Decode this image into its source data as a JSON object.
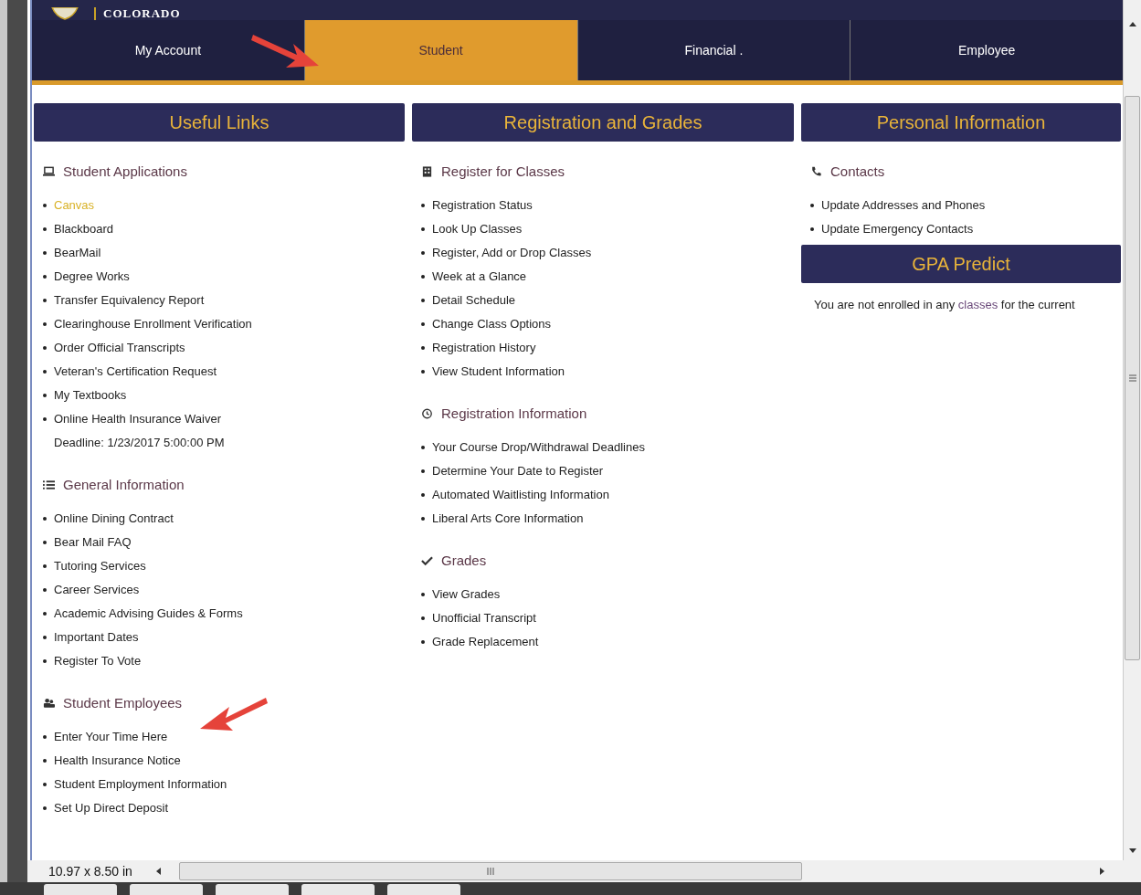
{
  "banner": {
    "title": "COLORADO"
  },
  "tabs": [
    {
      "label": "My Account",
      "selected": false
    },
    {
      "label": "Student",
      "selected": true
    },
    {
      "label": "Financial .",
      "selected": false
    },
    {
      "label": "Employee",
      "selected": false
    }
  ],
  "columns": [
    {
      "title": "Useful Links",
      "sections": [
        {
          "heading": "Student Applications",
          "kind": "laptop",
          "items": [
            {
              "label": "Canvas",
              "highlighted": true
            },
            {
              "label": "Blackboard",
              "highlighted": false
            },
            {
              "label": "BearMail",
              "highlighted": false
            },
            {
              "label": "Degree Works",
              "highlighted": false
            },
            {
              "label": "Transfer Equivalency Report",
              "highlighted": false
            },
            {
              "label": "Clearinghouse Enrollment Verification",
              "highlighted": false
            },
            {
              "label": "Order Official Transcripts",
              "highlighted": false
            },
            {
              "label": "Veteran's Certification Request",
              "highlighted": false
            },
            {
              "label": "My Textbooks",
              "highlighted": false
            },
            {
              "label": "Online Health Insurance Waiver",
              "note": "Deadline: 1/23/2017 5:00:00 PM",
              "highlighted": false
            }
          ]
        },
        {
          "heading": "General Information",
          "kind": "list",
          "items": [
            {
              "label": "Online Dining Contract",
              "highlighted": false
            },
            {
              "label": "Bear Mail FAQ",
              "highlighted": false
            },
            {
              "label": "Tutoring Services",
              "highlighted": false
            },
            {
              "label": "Career Services",
              "highlighted": false
            },
            {
              "label": "Academic Advising Guides & Forms",
              "highlighted": false
            },
            {
              "label": "Important Dates",
              "highlighted": false
            },
            {
              "label": "Register To Vote",
              "highlighted": false
            }
          ]
        },
        {
          "heading": "Student Employees",
          "kind": "users",
          "items": [
            {
              "label": "Enter Your Time Here",
              "highlighted": false
            },
            {
              "label": "Health Insurance Notice",
              "highlighted": false
            },
            {
              "label": "Student Employment Information",
              "highlighted": false
            },
            {
              "label": "Set Up Direct Deposit",
              "highlighted": false
            }
          ]
        }
      ]
    },
    {
      "title": "Registration and Grades",
      "sections": [
        {
          "heading": "Register for Classes",
          "kind": "building",
          "items": [
            {
              "label": "Registration Status",
              "highlighted": false
            },
            {
              "label": "Look Up Classes",
              "highlighted": false
            },
            {
              "label": "Register, Add or Drop Classes",
              "highlighted": false
            },
            {
              "label": "Week at a Glance",
              "highlighted": false
            },
            {
              "label": "Detail Schedule",
              "highlighted": false
            },
            {
              "label": "Change Class Options",
              "highlighted": false
            },
            {
              "label": "Registration History",
              "highlighted": false
            },
            {
              "label": "View Student Information",
              "highlighted": false
            }
          ]
        },
        {
          "heading": "Registration Information",
          "kind": "clock",
          "items": [
            {
              "label": "Your Course Drop/Withdrawal Deadlines",
              "highlighted": false
            },
            {
              "label": "Determine Your Date to Register",
              "highlighted": false
            },
            {
              "label": "Automated Waitlisting Information",
              "highlighted": false
            },
            {
              "label": "Liberal Arts Core Information",
              "highlighted": false
            }
          ]
        },
        {
          "heading": "Grades",
          "kind": "check",
          "items": [
            {
              "label": "View Grades",
              "highlighted": false
            },
            {
              "label": "Unofficial Transcript",
              "highlighted": false
            },
            {
              "label": "Grade Replacement",
              "highlighted": false
            }
          ]
        }
      ]
    },
    {
      "title": "Personal Information",
      "sections": [
        {
          "heading": "Contacts",
          "kind": "phone",
          "items": [
            {
              "label": "Update Addresses and Phones",
              "highlighted": false
            },
            {
              "label": "Update Emergency Contacts",
              "highlighted": false
            }
          ]
        }
      ],
      "subpanel": {
        "title": "GPA Predict",
        "message": {
          "before": "You are not enrolled in any",
          "link": "classes",
          "after": "for the current"
        }
      }
    }
  ],
  "status_bar": {
    "page_size": "10.97 x 8.50 in"
  }
}
